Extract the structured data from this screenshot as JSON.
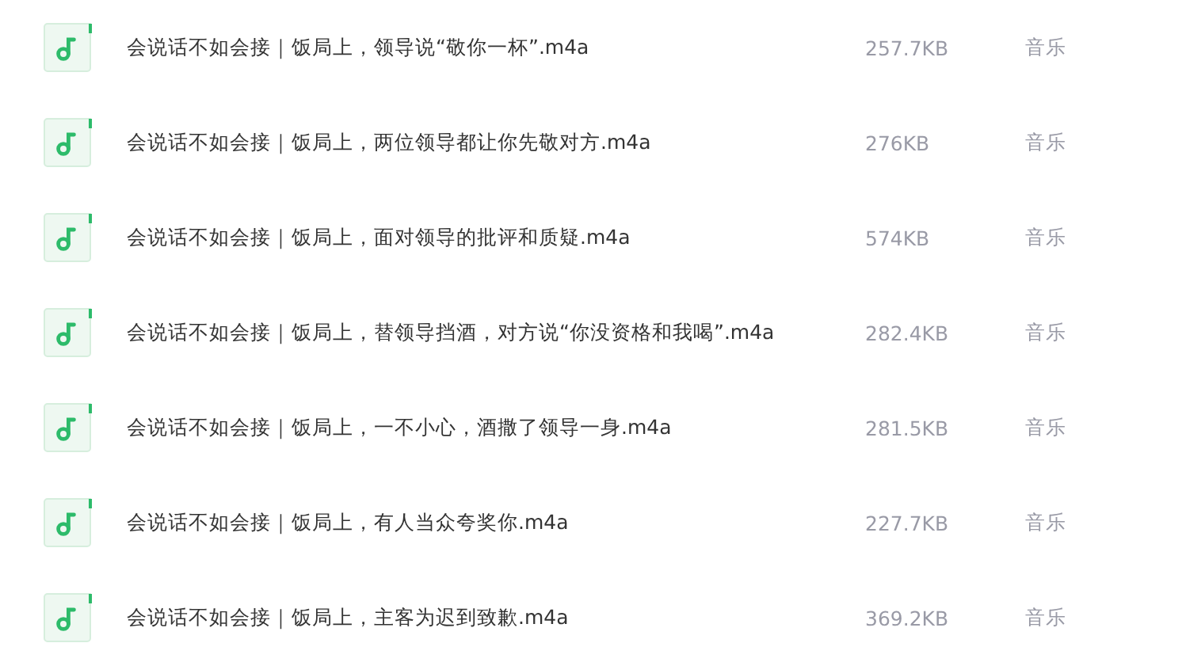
{
  "files": [
    {
      "name": "会说话不如会接｜饭局上，领导说“敬你一杯”.m4a",
      "size": "257.7KB",
      "type": "音乐"
    },
    {
      "name": "会说话不如会接｜饭局上，两位领导都让你先敬对方.m4a",
      "size": "276KB",
      "type": "音乐"
    },
    {
      "name": "会说话不如会接｜饭局上，面对领导的批评和质疑.m4a",
      "size": "574KB",
      "type": "音乐"
    },
    {
      "name": "会说话不如会接｜饭局上，替领导挡酒，对方说“你没资格和我喝”.m4a",
      "size": "282.4KB",
      "type": "音乐"
    },
    {
      "name": "会说话不如会接｜饭局上，一不小心，酒撒了领导一身.m4a",
      "size": "281.5KB",
      "type": "音乐"
    },
    {
      "name": "会说话不如会接｜饭局上，有人当众夸奖你.m4a",
      "size": "227.7KB",
      "type": "音乐"
    },
    {
      "name": "会说话不如会接｜饭局上，主客为迟到致歉.m4a",
      "size": "369.2KB",
      "type": "音乐"
    }
  ]
}
